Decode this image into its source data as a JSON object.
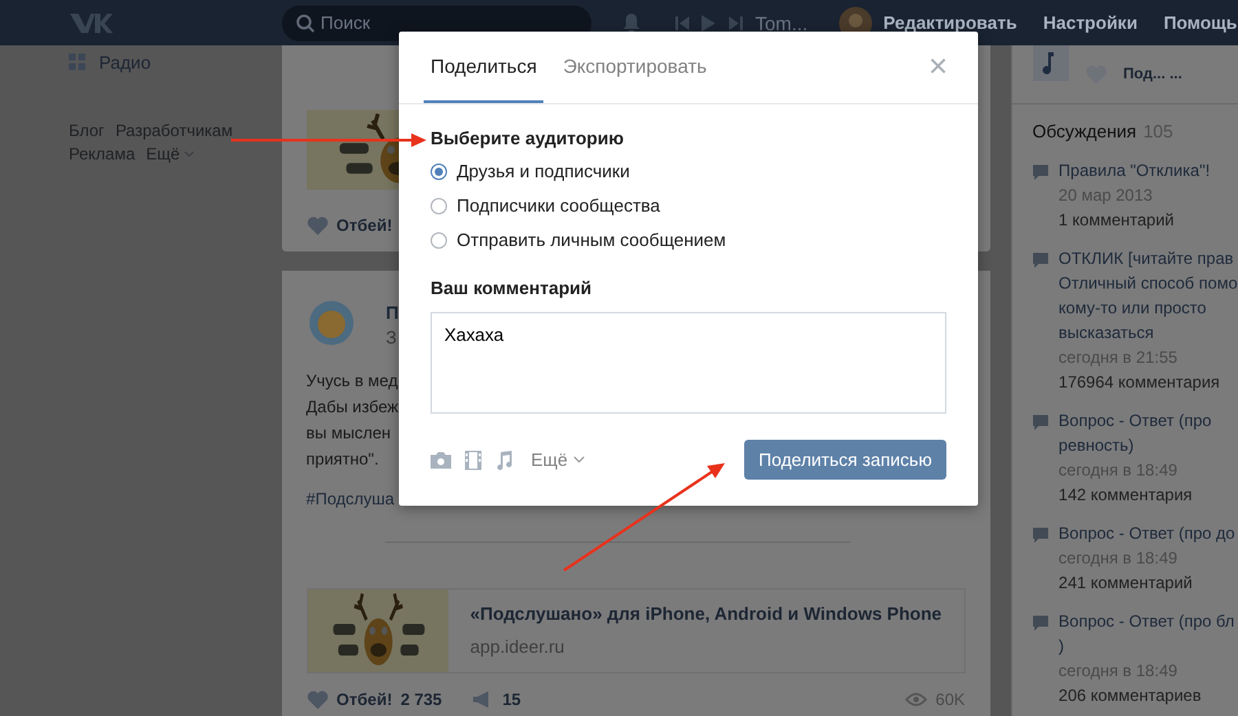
{
  "header": {
    "search": {
      "placeholder": "Поиск"
    },
    "player_track": "Tom...",
    "links": [
      "Редактировать",
      "Настройки",
      "Помощь"
    ]
  },
  "left_menu": {
    "items": [
      {
        "label": "Радио"
      }
    ],
    "footer_links": [
      "Блог",
      "Разработчикам",
      "Реклама",
      "Ещё"
    ]
  },
  "feed": {
    "post_1": {
      "likes_label": "Отбей!"
    },
    "post_2": {
      "author": "П",
      "date": "З",
      "text_lines": [
        "Учусь в мед",
        "Дабы избеж",
        "вы мыслен",
        "приятно\"."
      ],
      "hashtag": "#Подслуша",
      "link": {
        "title": "«Подслушано» для iPhone, Android и Windows Phone",
        "url": "app.ideer.ru"
      },
      "likes_label": "Отбей!",
      "likes": "2 735",
      "reposts": "15",
      "views": "60K"
    }
  },
  "right": {
    "group_title": "Под... ...",
    "discussions": {
      "title": "Обсуждения",
      "count": "105",
      "items": [
        {
          "title_lines": [
            "Правила \"Отклика\"!"
          ],
          "date": "20 мар 2013",
          "comments": "1 комментарий"
        },
        {
          "title_lines": [
            "ОТКЛИК [читайте прав",
            "Отличный способ помо",
            "кому-то или просто",
            "высказаться"
          ],
          "date": "сегодня в 21:55",
          "comments": "176964 комментария"
        },
        {
          "title_lines": [
            "Вопрос - Ответ (про",
            "ревность)"
          ],
          "date": "сегодня в 18:49",
          "comments": "142 комментария"
        },
        {
          "title_lines": [
            "Вопрос - Ответ (про до"
          ],
          "date": "сегодня в 18:49",
          "comments": "241 комментарий"
        },
        {
          "title_lines": [
            "Вопрос - Ответ (про бл",
            ")"
          ],
          "date": "сегодня в 18:49",
          "comments": "206 комментариев"
        }
      ]
    }
  },
  "dialog": {
    "tabs": [
      {
        "label": "Поделиться",
        "selected": true
      },
      {
        "label": "Экспортировать",
        "selected": false
      }
    ],
    "close": "×",
    "audience_title": "Выберите аудиторию",
    "audience": [
      {
        "label": "Друзья и подписчики",
        "selected": true
      },
      {
        "label": "Подписчики сообщества",
        "selected": false
      },
      {
        "label": "Отправить личным сообщением",
        "selected": false
      }
    ],
    "comment_title": "Ваш комментарий",
    "comment": "Хахаха",
    "more": "Ещё",
    "submit": "Поделиться записью"
  }
}
